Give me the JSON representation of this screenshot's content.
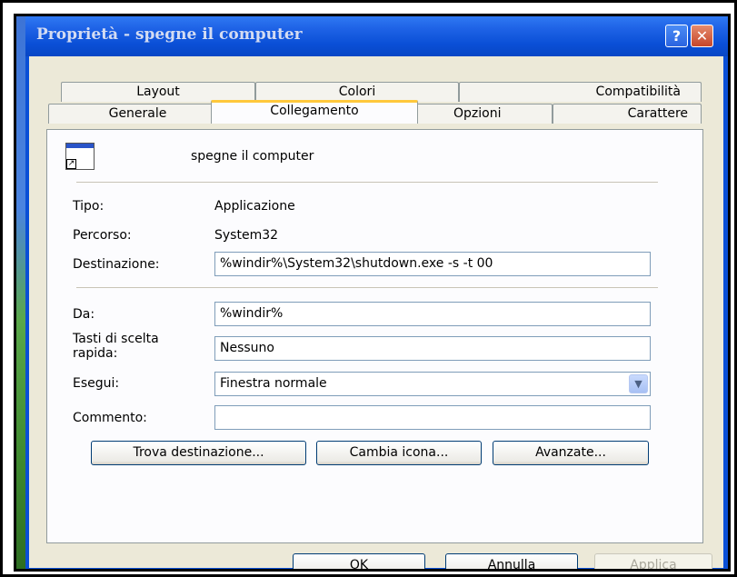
{
  "window": {
    "title": "Proprietà - spegne il computer",
    "help_label": "?",
    "close_label": "✕"
  },
  "tabs": {
    "row1": [
      "Layout",
      "Colori",
      "Compatibilità"
    ],
    "row2": [
      "Generale",
      "Collegamento",
      "Opzioni",
      "Carattere"
    ],
    "active": "Collegamento"
  },
  "shortcut": {
    "name": "spegne il computer",
    "tipo_label": "Tipo:",
    "tipo_value": "Applicazione",
    "percorso_label": "Percorso:",
    "percorso_value": "System32",
    "destinazione_label": "Destinazione:",
    "destinazione_value": "%windir%\\System32\\shutdown.exe -s -t 00",
    "da_label": "Da:",
    "da_value": "%windir%",
    "tasti_label_line1": "Tasti di scelta",
    "tasti_label_line2": "rapida:",
    "tasti_value": "Nessuno",
    "esegui_label": "Esegui:",
    "esegui_value": "Finestra normale",
    "commento_label": "Commento:",
    "commento_value": ""
  },
  "buttons": {
    "trova": "Trova destinazione...",
    "cambia": "Cambia icona...",
    "avanzate": "Avanzate...",
    "ok": "OK",
    "annulla": "Annulla",
    "applica": "Applica"
  },
  "colors": {
    "titlebar": "#0a4fd6",
    "dialog_bg": "#ece9d8",
    "active_tab_accent": "#ffc83c"
  }
}
